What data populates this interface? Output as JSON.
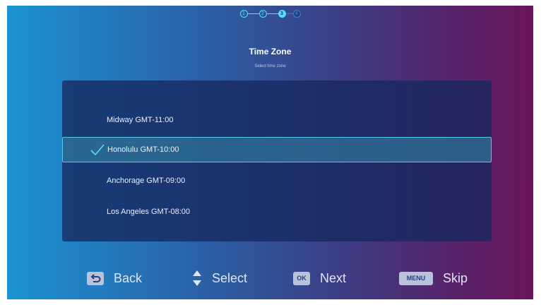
{
  "stepper": {
    "steps": [
      "1",
      "2",
      "3",
      "4"
    ],
    "current": 3
  },
  "header": {
    "title": "Time Zone",
    "subtitle": "Select time zone"
  },
  "timezone_list": {
    "items": [
      {
        "label": "Midway GMT-11:00",
        "selected": false
      },
      {
        "label": "Honolulu GMT-10:00",
        "selected": true
      },
      {
        "label": "Anchorage GMT-09:00",
        "selected": false
      },
      {
        "label": "Los Angeles GMT-08:00",
        "selected": false
      }
    ]
  },
  "hints": {
    "back": {
      "icon": "back-arrow-icon",
      "label": "Back"
    },
    "select": {
      "icon": "up-down-arrows-icon",
      "label": "Select"
    },
    "next": {
      "key": "OK",
      "label": "Next"
    },
    "skip": {
      "key": "MENU",
      "label": "Skip"
    }
  },
  "colors": {
    "accent": "#4fe1ff",
    "selected_border": "#58c9ea"
  }
}
